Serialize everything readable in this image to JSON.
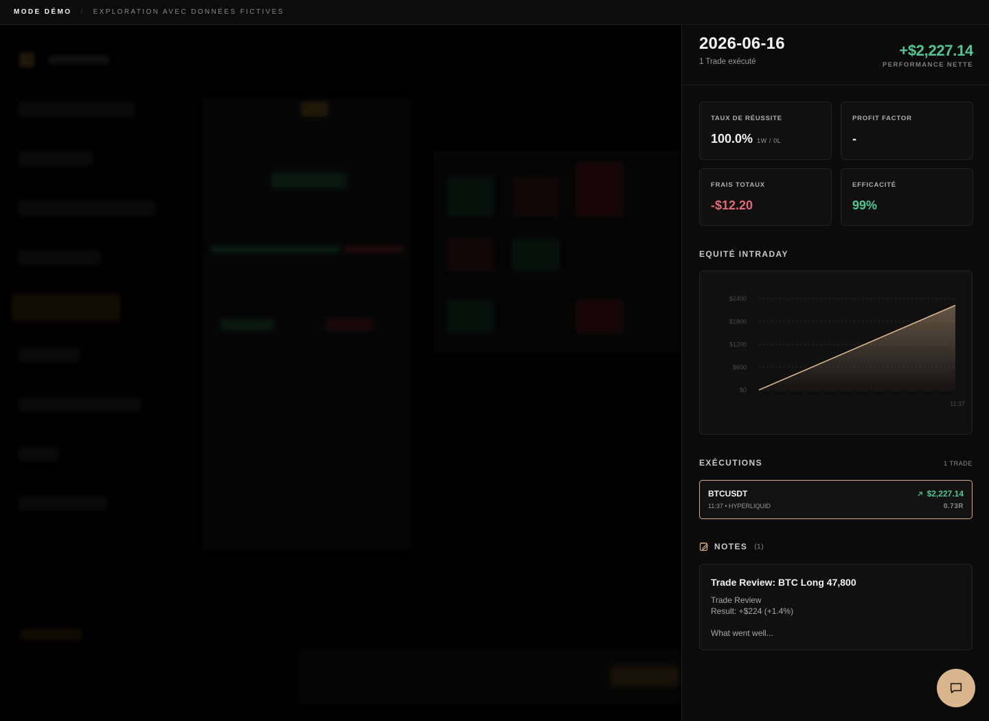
{
  "banner": {
    "mode": "MODE DÉMO",
    "separator": "/",
    "subtitle": "EXPLORATION AVEC DONNÉES FICTIVES"
  },
  "panel": {
    "date": "2026-06-16",
    "trade_count": "1 Trade exécuté",
    "net_pnl": "+$2,227.14",
    "net_pnl_label": "PERFORMANCE NETTE",
    "stats": {
      "win_rate": {
        "label": "TAUX DE RÉUSSITE",
        "value": "100.0%",
        "sub": "1W / 0L"
      },
      "profit_factor": {
        "label": "PROFIT FACTOR",
        "value": "-"
      },
      "fees": {
        "label": "FRAIS TOTAUX",
        "value": "-$12.20"
      },
      "efficiency": {
        "label": "EFFICACITÉ",
        "value": "99%"
      }
    },
    "equity_title": "EQUITÉ INTRADAY",
    "executions_title": "EXÉCUTIONS",
    "executions_count": "1 TRADE",
    "execution": {
      "symbol": "BTCUSDT",
      "meta": "11:37 • HYPERLIQUID",
      "pnl": "$2,227.14",
      "r_multiple": "0.73R"
    },
    "notes_title": "NOTES",
    "notes_count": "(1)",
    "note": {
      "title": "Trade Review: BTC Long 47,800",
      "line1": "Trade Review",
      "line2": "Result: +$224 (+1.4%)",
      "line3": "What went well..."
    }
  },
  "colors": {
    "profit": "#4fc793",
    "loss": "#e06a72",
    "accent": "#d9b58e"
  },
  "icons": {
    "trend": "arrow-up-right-icon",
    "notes": "note-edit-icon",
    "chat": "chat-bubble-icon"
  },
  "chart_data": {
    "type": "area",
    "title": "EQUITÉ INTRADAY",
    "x": [
      "start",
      "11:37"
    ],
    "x_tick_labels": [
      "11:37"
    ],
    "series": [
      {
        "values": [
          0,
          2227.14
        ]
      }
    ],
    "y_ticks": [
      "$0",
      "$600",
      "$1200",
      "$1800",
      "$2400"
    ],
    "ylim": [
      0,
      2400
    ],
    "grid": true
  }
}
